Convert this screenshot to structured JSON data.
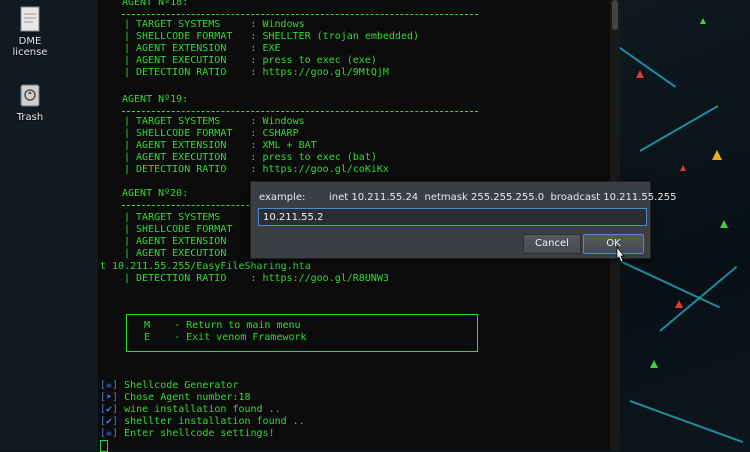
{
  "desktop": {
    "icons": [
      {
        "name": "license-file",
        "label": "DME license"
      },
      {
        "name": "trash",
        "label": "Trash"
      }
    ]
  },
  "terminal": {
    "agent18": {
      "title": "AGENT Nº18:",
      "rows": [
        "| TARGET SYSTEMS     : Windows",
        "| SHELLCODE FORMAT   : SHELLTER (trojan embedded)",
        "| AGENT EXTENSION    : EXE",
        "| AGENT EXECUTION    : press to exec (exe)",
        "| DETECTION RATIO    : https://goo.gl/9MtQjM"
      ]
    },
    "agent19": {
      "title": "AGENT Nº19:",
      "rows": [
        "| TARGET SYSTEMS     : Windows",
        "| SHELLCODE FORMAT   : CSHARP",
        "| AGENT EXTENSION    : XML + BAT",
        "| AGENT EXECUTION    : press to exec (bat)",
        "| DETECTION RATIO    : https://goo.gl/coKiKx"
      ]
    },
    "agent20": {
      "title": "AGENT Nº20:",
      "rows": [
        "| TARGET SYSTEMS     :",
        "| SHELLCODE FORMAT   :",
        "| AGENT EXTENSION    :",
        "| AGENT EXECUTION    :"
      ],
      "wrap_line": "t 10.211.55.255/EasyFileSharing.hta",
      "detection": "| DETECTION RATIO    : https://goo.gl/R8UNW3"
    },
    "menu": {
      "main": "M    - Return to main menu",
      "exit": "E    - Exit venom Framework"
    },
    "status": [
      {
        "prefix": "[☠]",
        "text": " Shellcode Generator"
      },
      {
        "prefix": "[➤]",
        "text": " Chose Agent number:18"
      },
      {
        "prefix": "[✔]",
        "text": " wine installation found .."
      },
      {
        "prefix": "[✔]",
        "text": " shellter installation found .."
      },
      {
        "prefix": "[☠]",
        "text": " Enter shellcode settings!"
      }
    ]
  },
  "dialog": {
    "example_label": "example:",
    "hint": "inet 10.211.55.24  netmask 255.255.255.0  broadcast 10.211.55.255",
    "input_value": "10.211.55.2",
    "cancel_label": "Cancel",
    "ok_label": "OK"
  },
  "colors": {
    "terminal_text": "#2fdc2f",
    "accent": "#4a8ad8"
  }
}
